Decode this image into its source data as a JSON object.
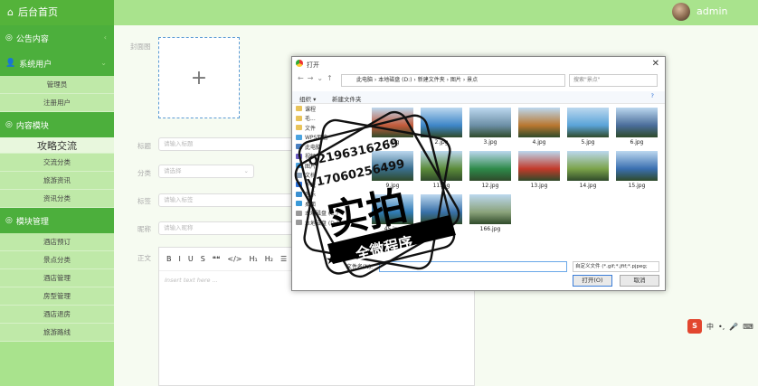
{
  "header": {
    "home_label": "后台首页",
    "user_name": "admin"
  },
  "sidebar": {
    "sections": [
      {
        "title": "公告内容"
      },
      {
        "title": "系统用户",
        "items": [
          "管理员",
          "注册用户"
        ]
      },
      {
        "title": "内容模块",
        "items": [
          "攻略交流",
          "交流分类",
          "旅游资讯",
          "资讯分类"
        ]
      },
      {
        "title": "模块管理",
        "items": [
          "酒店预订",
          "景点分类",
          "酒店管理",
          "房型管理",
          "酒店退房",
          "旅游路线"
        ]
      }
    ]
  },
  "form": {
    "cover_label": "封面图",
    "upload_symbol": "+",
    "title_label": "标题",
    "title_placeholder": "请输入标题",
    "category_label": "分类",
    "category_placeholder": "请选择",
    "tag_label": "标签",
    "tag_placeholder": "请输入标签",
    "nick_label": "昵称",
    "nick_placeholder": "请输入昵称",
    "content_label": "正文",
    "toolbar": [
      "B",
      "I",
      "U",
      "S",
      "❝❝",
      "</>",
      "H₁",
      "H₂",
      "☰"
    ],
    "editor_placeholder": "Insert text here ..."
  },
  "dialog": {
    "title": "打开",
    "path": [
      "此电脑",
      "本地磁盘 (D:)",
      "新建文件夹",
      "图片",
      "景点"
    ],
    "search_placeholder": "搜索\"景点\"",
    "organize": "组织 ▾",
    "new_folder": "新建文件夹",
    "tree": [
      "课程",
      "毛...",
      "文件",
      "WPS网盘",
      "此电脑",
      "视频",
      "图片",
      "文档",
      "下载",
      "音乐",
      "桌面",
      "本地磁盘 (C:)",
      "本地磁盘 (D:)"
    ],
    "files": [
      {
        "name": "1.jpg",
        "color": "#c35a3a"
      },
      {
        "name": "2.jpg",
        "color": "#3e86c8"
      },
      {
        "name": "3.jpg",
        "color": "#6c8fa6"
      },
      {
        "name": "4.jpg",
        "color": "#b9772f"
      },
      {
        "name": "5.jpg",
        "color": "#5aa3d8"
      },
      {
        "name": "6.jpg",
        "color": "#4a6d9a"
      },
      {
        "name": "9.jpg",
        "color": "#3a6f8f"
      },
      {
        "name": "11.jpg",
        "color": "#5b8c3a"
      },
      {
        "name": "12.jpg",
        "color": "#2e8a4a"
      },
      {
        "name": "13.jpg",
        "color": "#c23a2a"
      },
      {
        "name": "14.jpg",
        "color": "#7ba34a"
      },
      {
        "name": "15.jpg",
        "color": "#3a6fb0"
      },
      {
        "name": "45.jpg",
        "color": "#2f7bb5"
      },
      {
        "name": "65.jpg",
        "color": "#3870a8"
      },
      {
        "name": "166.jpg",
        "color": "#8aa27a"
      }
    ],
    "filename_label": "文件名(N):",
    "filetype": "自定义文件 (*.gif;*.jfif;*.pjpeg;",
    "open": "打开(O)",
    "cancel": "取消"
  },
  "watermark": {
    "line1": "Q2196316269",
    "line2": "V17060256499",
    "main": "实拍",
    "banner": "全微程序"
  },
  "ime": {
    "labels": [
      "S",
      "中",
      "•,",
      "🎤",
      "⌨",
      "⠿"
    ]
  }
}
